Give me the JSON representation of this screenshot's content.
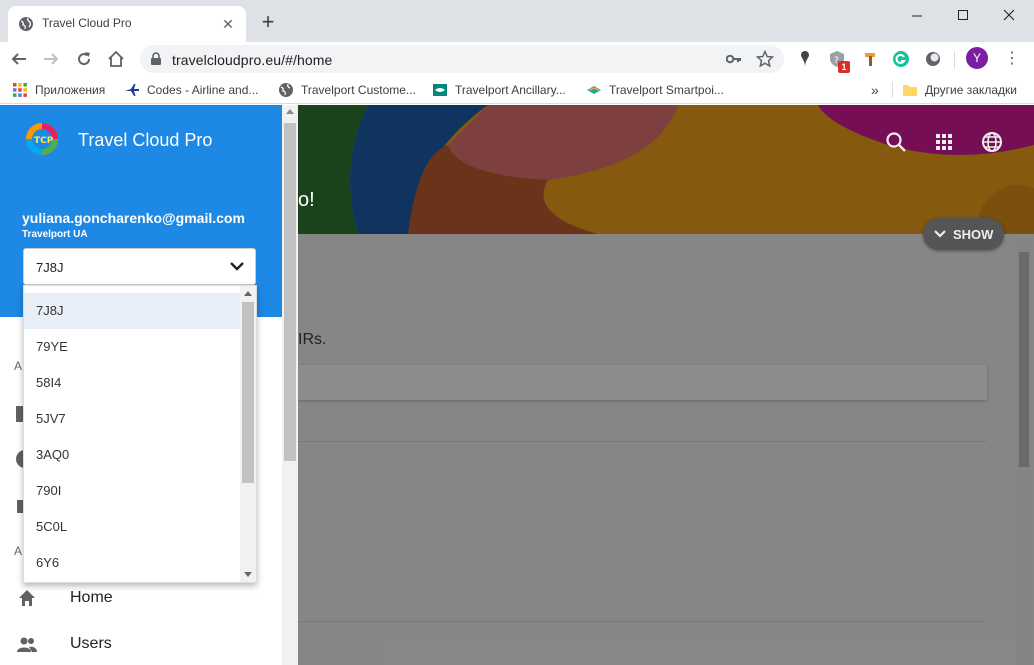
{
  "browser": {
    "tab_title": "Travel Cloud Pro",
    "url": "travelcloudpro.eu/#/home",
    "profile_initial": "Y",
    "extension_badge": "1"
  },
  "bookmarks": {
    "items": [
      {
        "label": "Приложения",
        "icon": "apps-grid-icon"
      },
      {
        "label": "Codes - Airline and...",
        "icon": "airplane-icon"
      },
      {
        "label": "Travelport Custome...",
        "icon": "globe-icon"
      },
      {
        "label": "Travelport Ancillary...",
        "icon": "ancillary-icon"
      },
      {
        "label": "Travelport Smartpoi...",
        "icon": "smartpoint-icon"
      }
    ],
    "overflow": "»",
    "other_label": "Другие закладки"
  },
  "drawer": {
    "app_title": "Travel Cloud Pro",
    "email": "yuliana.goncharenko@gmail.com",
    "org": "Travelport UA",
    "selected_pcc": "7J8J",
    "pcc_options": [
      "7J8J",
      "79YE",
      "58I4",
      "5JV7",
      "3AQ0",
      "790I",
      "5C0L",
      "6Y6"
    ],
    "section_letter_1": "A",
    "section_letter_2": "A",
    "nav": [
      {
        "label": "Home",
        "icon": "home-icon"
      },
      {
        "label": "Users",
        "icon": "users-icon"
      }
    ]
  },
  "main": {
    "hero_text": "o!",
    "show_button": "SHOW",
    "irs_text": "IRs."
  },
  "colors": {
    "drawer_header": "#1e88e5",
    "hero_orange": "#f2a21b",
    "hero_magenta": "#d81b9c",
    "avatar_purple": "#7b1fa2",
    "selected_option_bg": "#e8eff9"
  }
}
